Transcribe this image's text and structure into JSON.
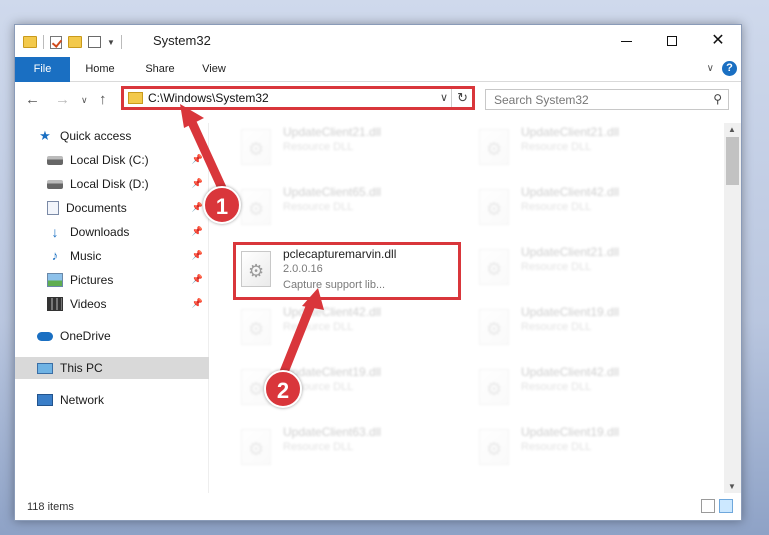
{
  "window": {
    "title": "System32",
    "controls": {
      "minimize": "minimize",
      "maximize": "maximize",
      "close": "✕"
    }
  },
  "ribbon": {
    "tabs": [
      {
        "label": "File"
      },
      {
        "label": "Home"
      },
      {
        "label": "Share"
      },
      {
        "label": "View"
      }
    ],
    "help": "?"
  },
  "navigation": {
    "address": "C:\\Windows\\System32",
    "search_placeholder": "Search System32"
  },
  "sidebar": {
    "items": [
      {
        "label": "Quick access",
        "icon": "star-icon"
      },
      {
        "label": "Local Disk (C:)",
        "icon": "disk-icon",
        "pinned": true
      },
      {
        "label": "Local Disk (D:)",
        "icon": "disk-icon",
        "pinned": true
      },
      {
        "label": "Documents",
        "icon": "documents-icon",
        "pinned": true
      },
      {
        "label": "Downloads",
        "icon": "downloads-icon",
        "pinned": true
      },
      {
        "label": "Music",
        "icon": "music-icon",
        "pinned": true
      },
      {
        "label": "Pictures",
        "icon": "pictures-icon",
        "pinned": true
      },
      {
        "label": "Videos",
        "icon": "videos-icon",
        "pinned": true
      },
      {
        "label": "OneDrive",
        "icon": "onedrive-icon"
      },
      {
        "label": "This PC",
        "icon": "this-pc-icon",
        "selected": true
      },
      {
        "label": "Network",
        "icon": "network-icon"
      }
    ]
  },
  "files": {
    "highlighted": {
      "name": "pclecapturemarvin.dll",
      "version": "2.0.0.16",
      "description": "Capture support lib..."
    },
    "background": [
      {
        "name": "UpdateClient21.dll",
        "type": "Resource DLL"
      },
      {
        "name": "UpdateClient21.dll",
        "type": "Resource DLL"
      },
      {
        "name": "UpdateClient65.dll",
        "type": "Resource DLL"
      },
      {
        "name": "UpdateClient42.dll",
        "type": "Resource DLL"
      },
      {
        "name": "UpdateClient21.dll",
        "type": "Resource DLL"
      },
      {
        "name": "UpdateClient42.dll",
        "type": "Resource DLL"
      },
      {
        "name": "UpdateClient19.dll",
        "type": "Resource DLL"
      },
      {
        "name": "UpdateClient19.dll",
        "type": "Resource DLL"
      },
      {
        "name": "UpdateClient42.dll",
        "type": "Resource DLL"
      },
      {
        "name": "UpdateClient63.dll",
        "type": "Resource DLL"
      },
      {
        "name": "UpdateClient19.dll",
        "type": "Resource DLL"
      }
    ]
  },
  "status": {
    "item_count": "118 items"
  },
  "annotations": {
    "badge_1": "1",
    "badge_2": "2",
    "color": "#d9363b"
  }
}
